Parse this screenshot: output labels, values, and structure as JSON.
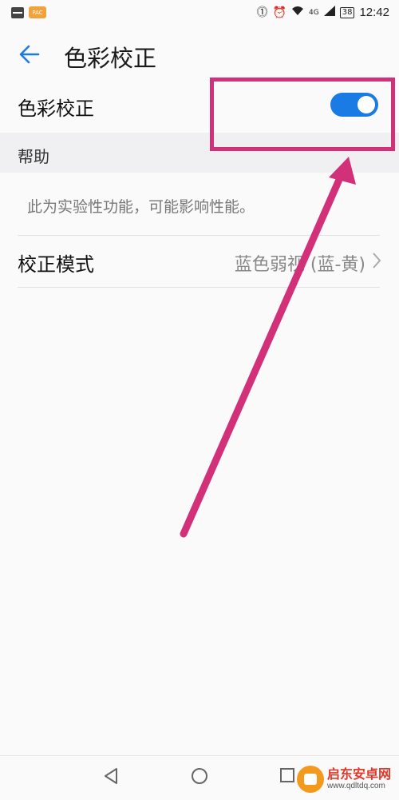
{
  "status_bar": {
    "left_icons": [
      "activity-app-icon",
      "sms-app-icon"
    ],
    "app2_label": "PAC",
    "right_icons": [
      "hd-icon",
      "alarm-icon",
      "wifi-icon",
      "signal-icon"
    ],
    "signal_label": "4G",
    "battery": "38",
    "time": "12:42"
  },
  "header": {
    "title": "色彩校正"
  },
  "settings": {
    "color_correction_label": "色彩校正",
    "color_correction_enabled": true,
    "section_header": "帮助",
    "help_text": "此为实验性功能，可能影响性能。",
    "mode_label": "校正模式",
    "mode_value": "蓝色弱视 (蓝-黄)"
  },
  "annotation": {
    "color": "#d3307a"
  },
  "watermark": {
    "title": "启东安卓网",
    "url": "www.qdltdq.com"
  },
  "colors": {
    "accent": "#1b7be5",
    "background": "#fafafa",
    "section_bg": "#f0f0f2"
  }
}
